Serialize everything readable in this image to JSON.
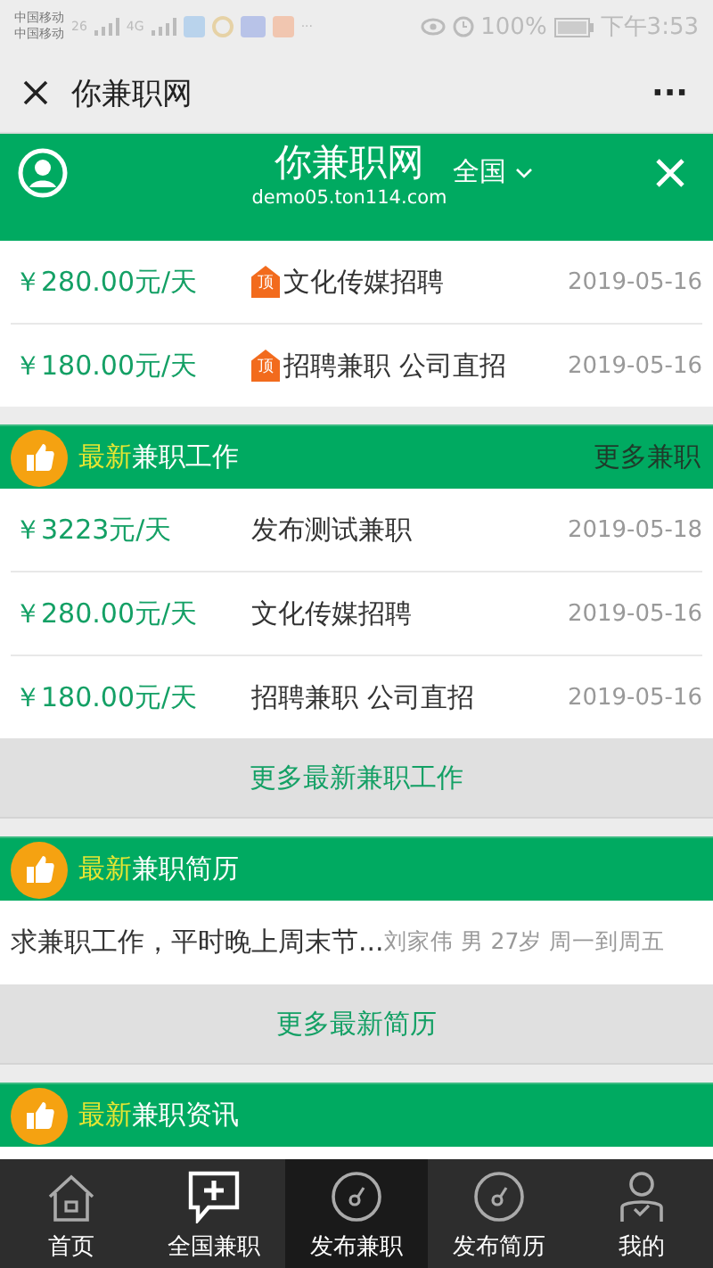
{
  "status_bar": {
    "carrier_1": "中国移动",
    "carrier_2": "中国移动",
    "signal_1": "26",
    "signal_2": "4G",
    "more": "···",
    "battery": "100%",
    "time": "下午3:53"
  },
  "nav": {
    "title": "你兼职网",
    "menu": "···"
  },
  "header": {
    "title": "你兼职网",
    "subtitle": "demo05.ton114.com",
    "region": "全国"
  },
  "top_rows": [
    {
      "price": "￥280.00元/天",
      "badge": "顶",
      "title": "文化传媒招聘",
      "date": "2019-05-16"
    },
    {
      "price": "￥180.00元/天",
      "badge": "顶",
      "title": "招聘兼职 公司直招",
      "date": "2019-05-16"
    }
  ],
  "jobs": {
    "highlight": "最新",
    "title": "兼职工作",
    "more": "更多兼职",
    "rows": [
      {
        "price": "￥3223元/天",
        "title": "发布测试兼职",
        "date": "2019-05-18"
      },
      {
        "price": "￥280.00元/天",
        "title": "文化传媒招聘",
        "date": "2019-05-16"
      },
      {
        "price": "￥180.00元/天",
        "title": "招聘兼职 公司直招",
        "date": "2019-05-16"
      }
    ],
    "more_button": "更多最新兼职工作"
  },
  "resumes": {
    "highlight": "最新",
    "title": "兼职简历",
    "rows": [
      {
        "text": "求兼职工作，平时晚上周末节...",
        "detail": "刘家伟 男 27岁 周一到周五"
      }
    ],
    "more_button": "更多最新简历"
  },
  "news": {
    "highlight": "最新",
    "title": "兼职资讯"
  },
  "tabbar": [
    {
      "label": "首页",
      "kind": "home",
      "selected": false
    },
    {
      "label": "全国兼职",
      "kind": "chat",
      "selected": false
    },
    {
      "label": "发布兼职",
      "kind": "dial",
      "selected": true
    },
    {
      "label": "发布简历",
      "kind": "dial",
      "selected": false
    },
    {
      "label": "我的",
      "kind": "user",
      "selected": false
    }
  ]
}
